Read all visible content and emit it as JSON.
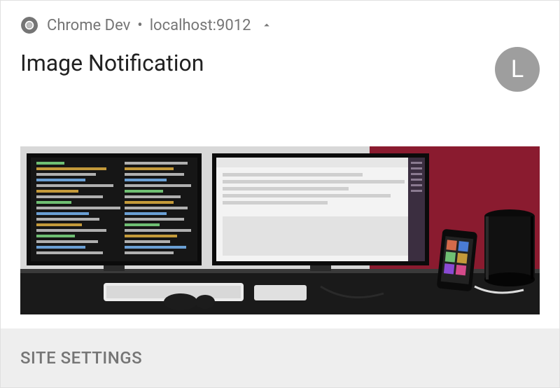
{
  "header": {
    "app_name": "Chrome Dev",
    "origin": "localhost:9012"
  },
  "notification": {
    "title": "Image Notification",
    "avatar_letter": "L"
  },
  "actions": {
    "site_settings": "SITE SETTINGS"
  }
}
